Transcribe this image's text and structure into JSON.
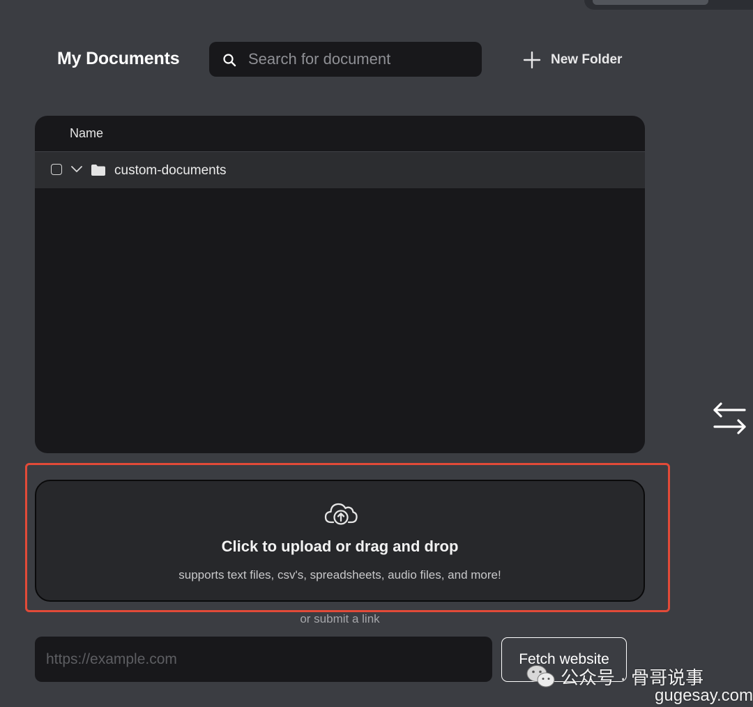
{
  "header": {
    "title": "My Documents",
    "search": {
      "placeholder": "Search for document",
      "value": ""
    },
    "new_folder_label": "New Folder"
  },
  "documents": {
    "column_header": "Name",
    "rows": [
      {
        "label": "custom-documents",
        "type": "folder",
        "expanded": true,
        "checked": false
      }
    ]
  },
  "upload": {
    "title": "Click to upload or drag and drop",
    "subtitle": "supports text files, csv's, spreadsheets, audio files, and more!"
  },
  "link": {
    "divider_text": "or submit a link",
    "url_placeholder": "https://example.com",
    "fetch_button_label": "Fetch website"
  },
  "watermark": {
    "account": "公众号 · 骨哥说事",
    "site": "gugesay.com"
  },
  "icons": {
    "search": "search-icon",
    "new_folder": "plus-icon",
    "row_expand": "chevron-down-icon",
    "row_type": "folder-icon",
    "upload": "cloud-upload-icon",
    "swap": "swap-arrows-icon",
    "watermark_logo": "wechat-icon"
  },
  "colors": {
    "background": "#3b3d42",
    "panel": "#18181b",
    "row_highlight": "#2c2d30",
    "upload_zone": "#27282b",
    "annotation_border": "#e24a38",
    "text": "#ffffff"
  }
}
